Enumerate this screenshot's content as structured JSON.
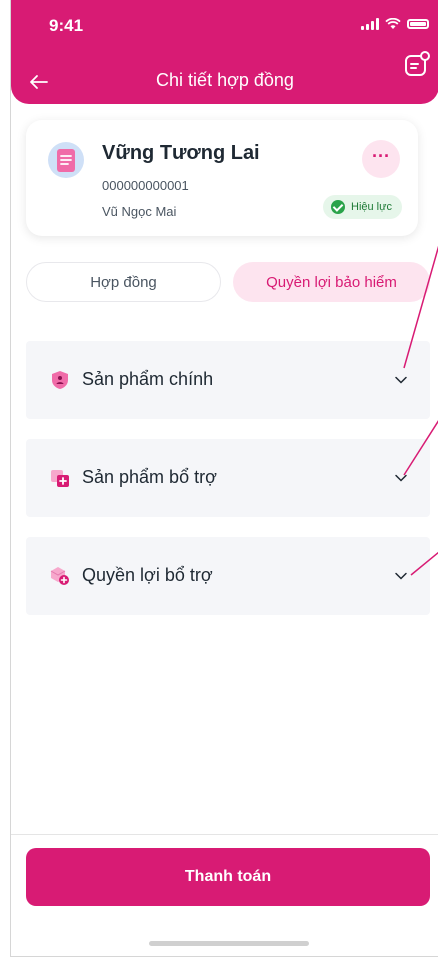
{
  "status_bar": {
    "time": "9:41"
  },
  "header": {
    "title": "Chi tiết hợp đồng"
  },
  "contract_card": {
    "name": "Vững Tương Lai",
    "number": "000000000001",
    "owner": "Vũ Ngọc Mai",
    "status": "Hiệu lực",
    "more_label": "···"
  },
  "tabs": [
    {
      "label": "Hợp đồng",
      "active": false
    },
    {
      "label": "Quyền lợi bảo hiểm",
      "active": true
    }
  ],
  "sections": [
    {
      "label": "Sản phẩm chính",
      "icon": "shield-user-icon"
    },
    {
      "label": "Sản phẩm bổ trợ",
      "icon": "add-product-icon"
    },
    {
      "label": "Quyền lợi bổ trợ",
      "icon": "box-add-icon"
    }
  ],
  "footer": {
    "pay_label": "Thanh toán"
  },
  "colors": {
    "brand": "#d81b74",
    "brand_light": "#fde4ef",
    "success": "#2aa34a",
    "section_bg": "#f5f6f9"
  }
}
